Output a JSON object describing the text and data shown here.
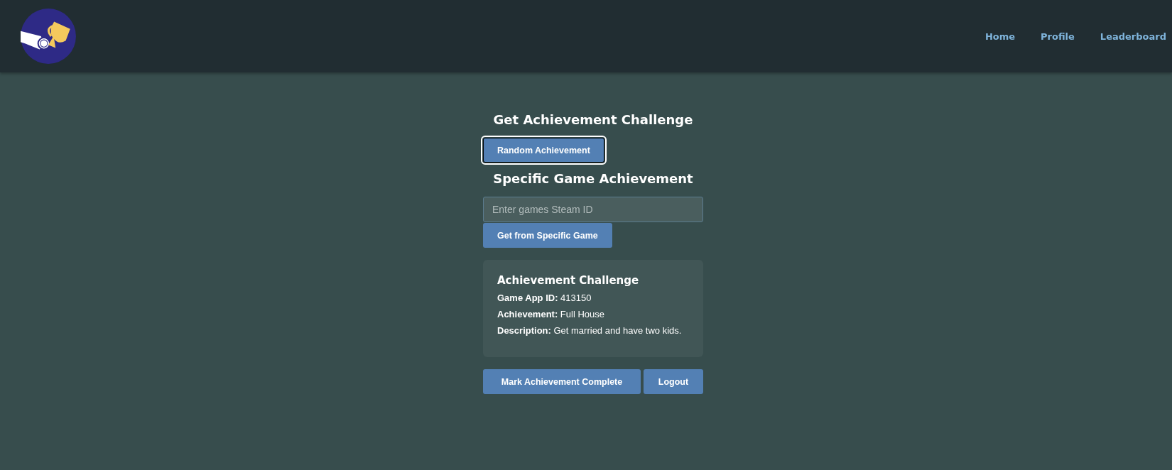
{
  "header": {
    "nav": [
      {
        "label": "Home"
      },
      {
        "label": "Profile"
      },
      {
        "label": "Leaderboard"
      }
    ]
  },
  "challenge": {
    "title": "Get Achievement Challenge",
    "random_button": {
      "label": "Random Achievement",
      "focused": true
    },
    "specific_title": "Specific Game Achievement",
    "search": {
      "placeholder": "Enter games Steam ID"
    },
    "specific_button": {
      "label": "Get from Specific Game"
    }
  },
  "result": {
    "title": "Achievement Challenge",
    "lines": [
      "**Game App ID:** 413150",
      "**Achievement:** Full House",
      "**Description:** Get married and have two kids."
    ]
  },
  "actions": [
    {
      "label": "Mark Achievement Complete"
    },
    {
      "label": "Logout"
    }
  ]
}
